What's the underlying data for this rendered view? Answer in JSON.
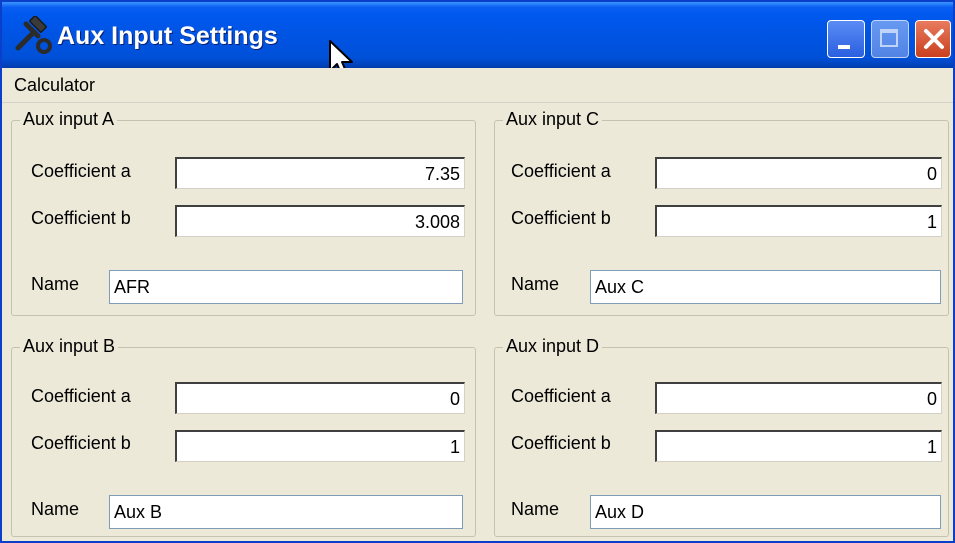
{
  "window": {
    "title": "Aux Input Settings",
    "controls": [
      "minimize",
      "maximize",
      "close"
    ]
  },
  "menu": {
    "items": [
      "Calculator"
    ]
  },
  "groups": {
    "a": {
      "legend": "Aux input A",
      "coef_a_label": "Coefficient a",
      "coef_a_value": "7.35",
      "coef_b_label": "Coefficient b",
      "coef_b_value": "3.008",
      "name_label": "Name",
      "name_value": "AFR"
    },
    "b": {
      "legend": "Aux input B",
      "coef_a_label": "Coefficient a",
      "coef_a_value": "0",
      "coef_b_label": "Coefficient b",
      "coef_b_value": "1",
      "name_label": "Name",
      "name_value": "Aux B"
    },
    "c": {
      "legend": "Aux input C",
      "coef_a_label": "Coefficient a",
      "coef_a_value": "0",
      "coef_b_label": "Coefficient b",
      "coef_b_value": "1",
      "name_label": "Name",
      "name_value": "Aux C"
    },
    "d": {
      "legend": "Aux input D",
      "coef_a_label": "Coefficient a",
      "coef_a_value": "0",
      "coef_b_label": "Coefficient b",
      "coef_b_value": "1",
      "name_label": "Name",
      "name_value": "Aux D"
    }
  },
  "icons": {
    "app": "hammer-wrench-icon",
    "cursor": "mouse-pointer-icon"
  },
  "colors": {
    "titlebar": "#0054e3",
    "window_bg": "#ece9d8",
    "close_button": "#d4502e"
  }
}
